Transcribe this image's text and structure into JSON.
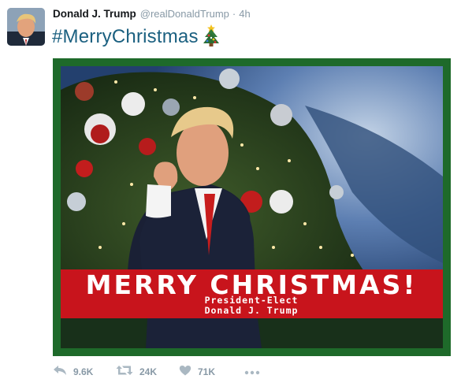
{
  "tweet": {
    "author": {
      "display_name": "Donald J. Trump",
      "handle": "@realDonaldTrump",
      "time": "4h",
      "separator": "·"
    },
    "text": "#MerryChristmas",
    "emoji": "christmas-tree",
    "media": {
      "banner_title": "MERRY CHRISTMAS!",
      "banner_line1": "President-Elect",
      "banner_line2": "Donald J. Trump",
      "frame_color": "#1e6a2a",
      "banner_color": "#c8141c"
    },
    "actions": {
      "reply_count": "9.6K",
      "retweet_count": "24K",
      "like_count": "71K"
    }
  },
  "colors": {
    "secondary_text": "#8899a6",
    "hashtag": "#1b6080",
    "icon": "#aab8c2"
  }
}
